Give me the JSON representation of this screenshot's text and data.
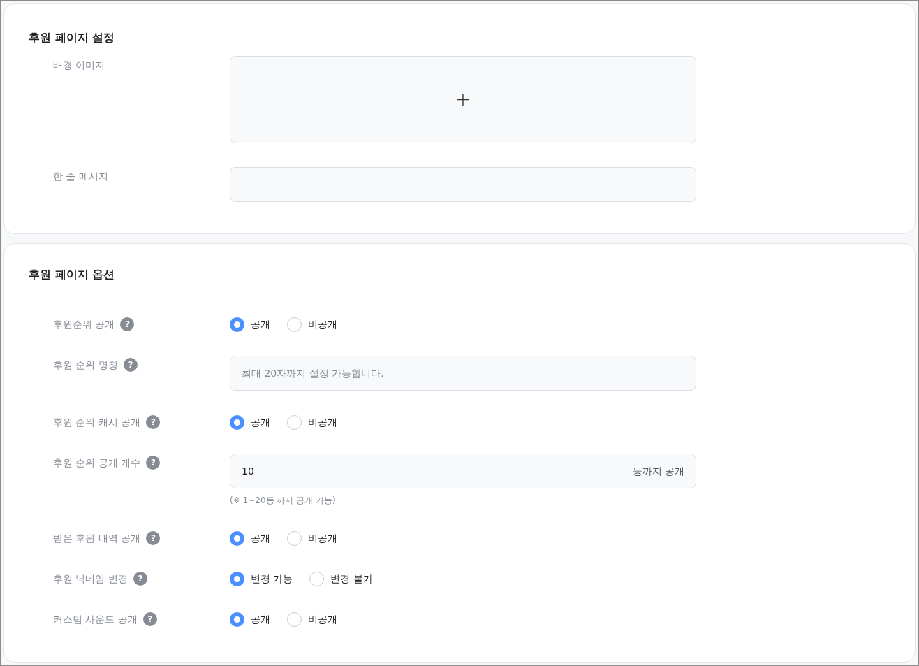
{
  "sections": [
    {
      "title": "후원 페이지 설정",
      "rows": [
        {
          "kind": "image",
          "label": "배경 이미지",
          "add": "+"
        },
        {
          "kind": "text",
          "label": "한 줄 메시지"
        }
      ]
    },
    {
      "title": "후원 페이지 옵션",
      "rows": [
        {
          "kind": "radio",
          "label": "후원순위 공개",
          "help": "?",
          "options": [
            {
              "label": "공개",
              "selected": true
            },
            {
              "label": "비공개",
              "selected": false
            }
          ]
        },
        {
          "kind": "text",
          "label": "후원 순위 명칭",
          "help": "?",
          "placeholder": "최대 20자까지 설정 가능합니다."
        },
        {
          "kind": "radio",
          "label": "후원 순위 캐시 공개",
          "help": "?",
          "options": [
            {
              "label": "공개",
              "selected": true
            },
            {
              "label": "비공개",
              "selected": false
            }
          ]
        },
        {
          "kind": "number",
          "label": "후원 순위 공개 개수",
          "help": "?",
          "value": "10",
          "suffix": "등까지 공개",
          "hint": "(※ 1~20등 까지 공개 가능)"
        },
        {
          "kind": "radio",
          "label": "받은 후원 내역 공개",
          "help": "?",
          "options": [
            {
              "label": "공개",
              "selected": true
            },
            {
              "label": "비공개",
              "selected": false
            }
          ]
        },
        {
          "kind": "radio",
          "label": "후원 닉네임 변경",
          "help": "?",
          "options": [
            {
              "label": "변경 가능",
              "selected": true
            },
            {
              "label": "변경 불가",
              "selected": false
            }
          ]
        },
        {
          "kind": "radio",
          "label": "커스텀 사운드 공개",
          "help": "?",
          "options": [
            {
              "label": "공개",
              "selected": true
            },
            {
              "label": "비공개",
              "selected": false
            }
          ]
        }
      ]
    }
  ]
}
